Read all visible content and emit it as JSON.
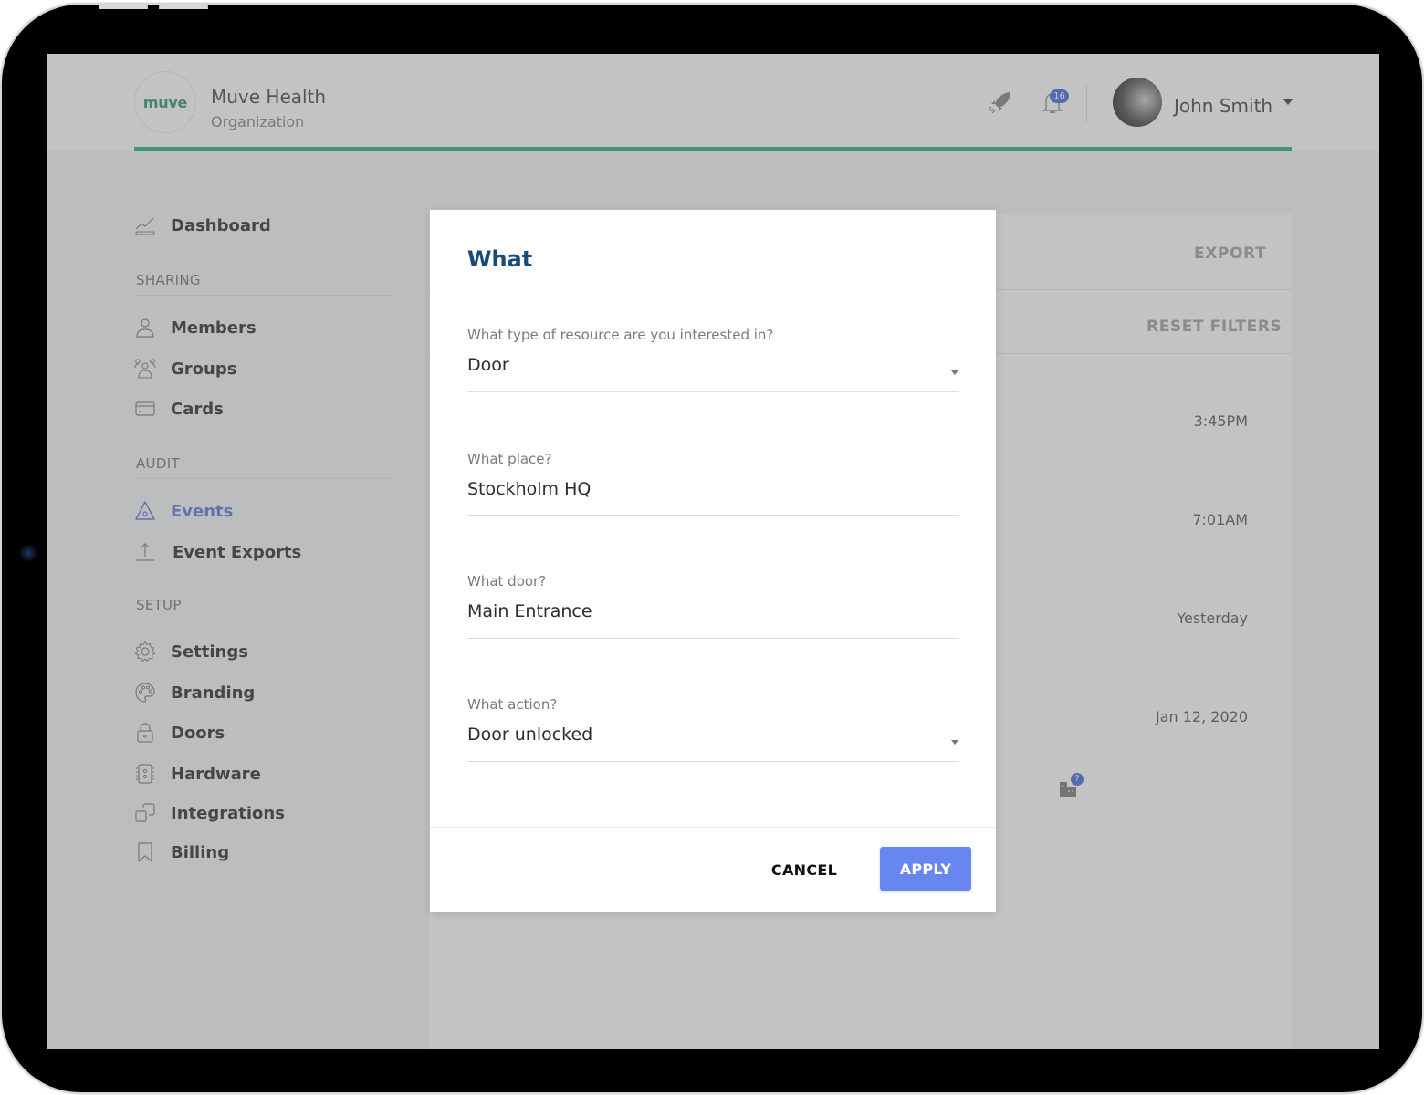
{
  "header": {
    "logo_text": "muve",
    "org_name": "Muve Health",
    "org_subtitle": "Organization",
    "notifications_count": "16",
    "user_name": "John Smith",
    "accent_color": "#1aa97a"
  },
  "sidebar": {
    "dashboard": {
      "label": "Dashboard",
      "icon": "chart-line-icon"
    },
    "sections": [
      {
        "title": "SHARING",
        "items": [
          {
            "label": "Members",
            "icon": "person-icon"
          },
          {
            "label": "Groups",
            "icon": "group-icon"
          },
          {
            "label": "Cards",
            "icon": "card-icon"
          }
        ]
      },
      {
        "title": "AUDIT",
        "items": [
          {
            "label": "Events",
            "icon": "warning-triangle-icon",
            "active": true
          },
          {
            "label": "Event Exports",
            "icon": "upload-icon"
          }
        ]
      },
      {
        "title": "SETUP",
        "items": [
          {
            "label": "Settings",
            "icon": "gear-icon"
          },
          {
            "label": "Branding",
            "icon": "palette-icon"
          },
          {
            "label": "Doors",
            "icon": "lock-icon"
          },
          {
            "label": "Hardware",
            "icon": "hardware-icon"
          },
          {
            "label": "Integrations",
            "icon": "integrations-icon"
          },
          {
            "label": "Billing",
            "icon": "bookmark-icon"
          }
        ]
      }
    ],
    "active_color": "#4e6fd6"
  },
  "panel": {
    "export_label": "EXPORT",
    "reset_filters_label": "RESET FILTERS",
    "events": [
      {
        "time": "3:45PM"
      },
      {
        "time": "7:01AM"
      },
      {
        "time": "Yesterday",
        "badge": "7"
      },
      {
        "time": "Jan 12, 2020"
      }
    ]
  },
  "modal": {
    "title": "What",
    "fields": [
      {
        "label": "What type of resource are you interested in?",
        "value": "Door",
        "type": "select"
      },
      {
        "label": "What place?",
        "value": "Stockholm HQ",
        "type": "text"
      },
      {
        "label": "What door?",
        "value": "Main Entrance",
        "type": "text"
      },
      {
        "label": "What action?",
        "value": "Door unlocked",
        "type": "select"
      }
    ],
    "cancel_label": "CANCEL",
    "apply_label": "APPLY",
    "apply_color": "#6886ef",
    "title_color": "#174a7c"
  }
}
